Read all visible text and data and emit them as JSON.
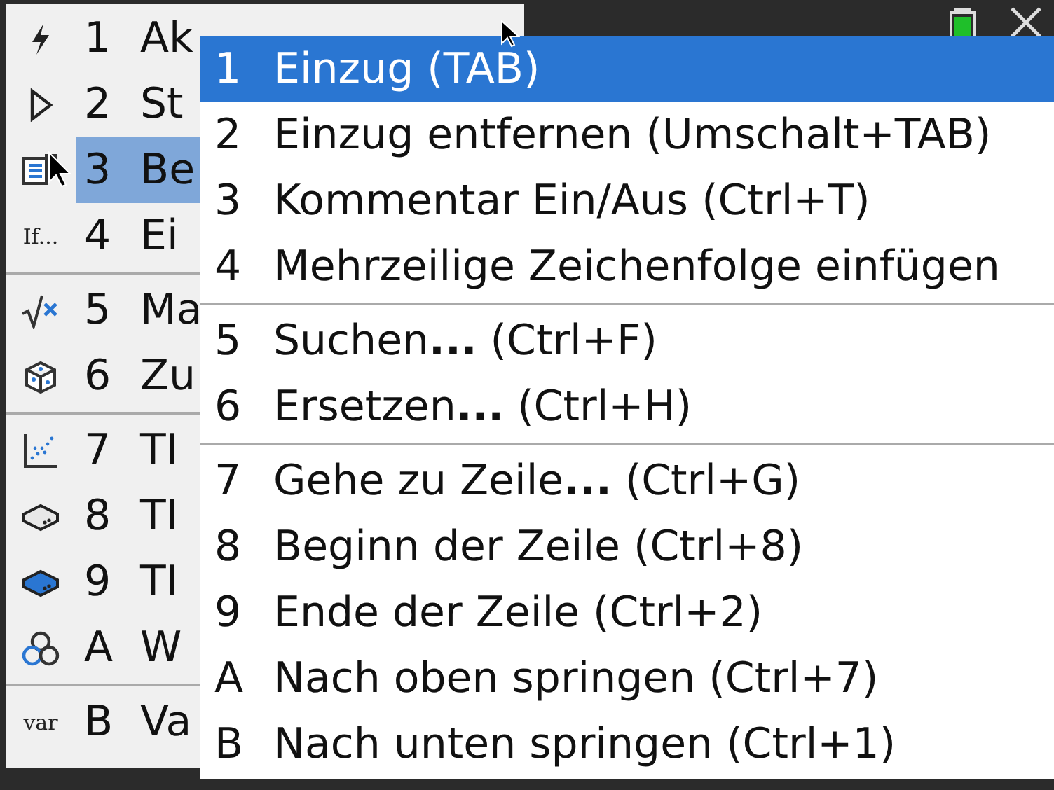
{
  "main_menu": {
    "items": [
      {
        "key": "1",
        "label": "Ak",
        "selected": false
      },
      {
        "key": "2",
        "label": "St",
        "selected": false
      },
      {
        "key": "3",
        "label": "Be",
        "selected": true
      },
      {
        "icon_text": "If...",
        "key": "4",
        "label": "Ei",
        "selected": false,
        "separator_after": true
      },
      {
        "key": "5",
        "label": "Ma",
        "selected": false
      },
      {
        "key": "6",
        "label": "Zu",
        "selected": false,
        "separator_after": true
      },
      {
        "key": "7",
        "label": "TI",
        "selected": false
      },
      {
        "key": "8",
        "label": "TI",
        "selected": false
      },
      {
        "key": "9",
        "label": "TI",
        "selected": false
      },
      {
        "key": "A",
        "label": "W",
        "selected": false,
        "separator_after": true
      },
      {
        "icon_text": "var",
        "key": "B",
        "label": "Va",
        "selected": false
      }
    ]
  },
  "submenu": {
    "items": [
      {
        "key": "1",
        "label": "Einzug (TAB)",
        "selected": true
      },
      {
        "key": "2",
        "label": "Einzug entfernen (Umschalt+TAB)",
        "selected": false
      },
      {
        "key": "3",
        "label": "Kommentar Ein/Aus (Ctrl+T)",
        "selected": false
      },
      {
        "key": "4",
        "label": "Mehrzeilige Zeichenfolge einfügen",
        "selected": false,
        "separator_after": true
      },
      {
        "key": "5",
        "label": "Suchen**...** (Ctrl+F)",
        "selected": false
      },
      {
        "key": "6",
        "label": "Ersetzen**...** (Ctrl+H)",
        "selected": false,
        "separator_after": true
      },
      {
        "key": "7",
        "label": "Gehe zu Zeile**...** (Ctrl+G)",
        "selected": false
      },
      {
        "key": "8",
        "label": "Beginn der Zeile (Ctrl+8)",
        "selected": false
      },
      {
        "key": "9",
        "label": "Ende der Zeile (Ctrl+2)",
        "selected": false
      },
      {
        "key": "A",
        "label": "Nach oben springen (Ctrl+7)",
        "selected": false
      },
      {
        "key": "B",
        "label": "Nach unten springen (Ctrl+1)",
        "selected": false
      }
    ]
  }
}
